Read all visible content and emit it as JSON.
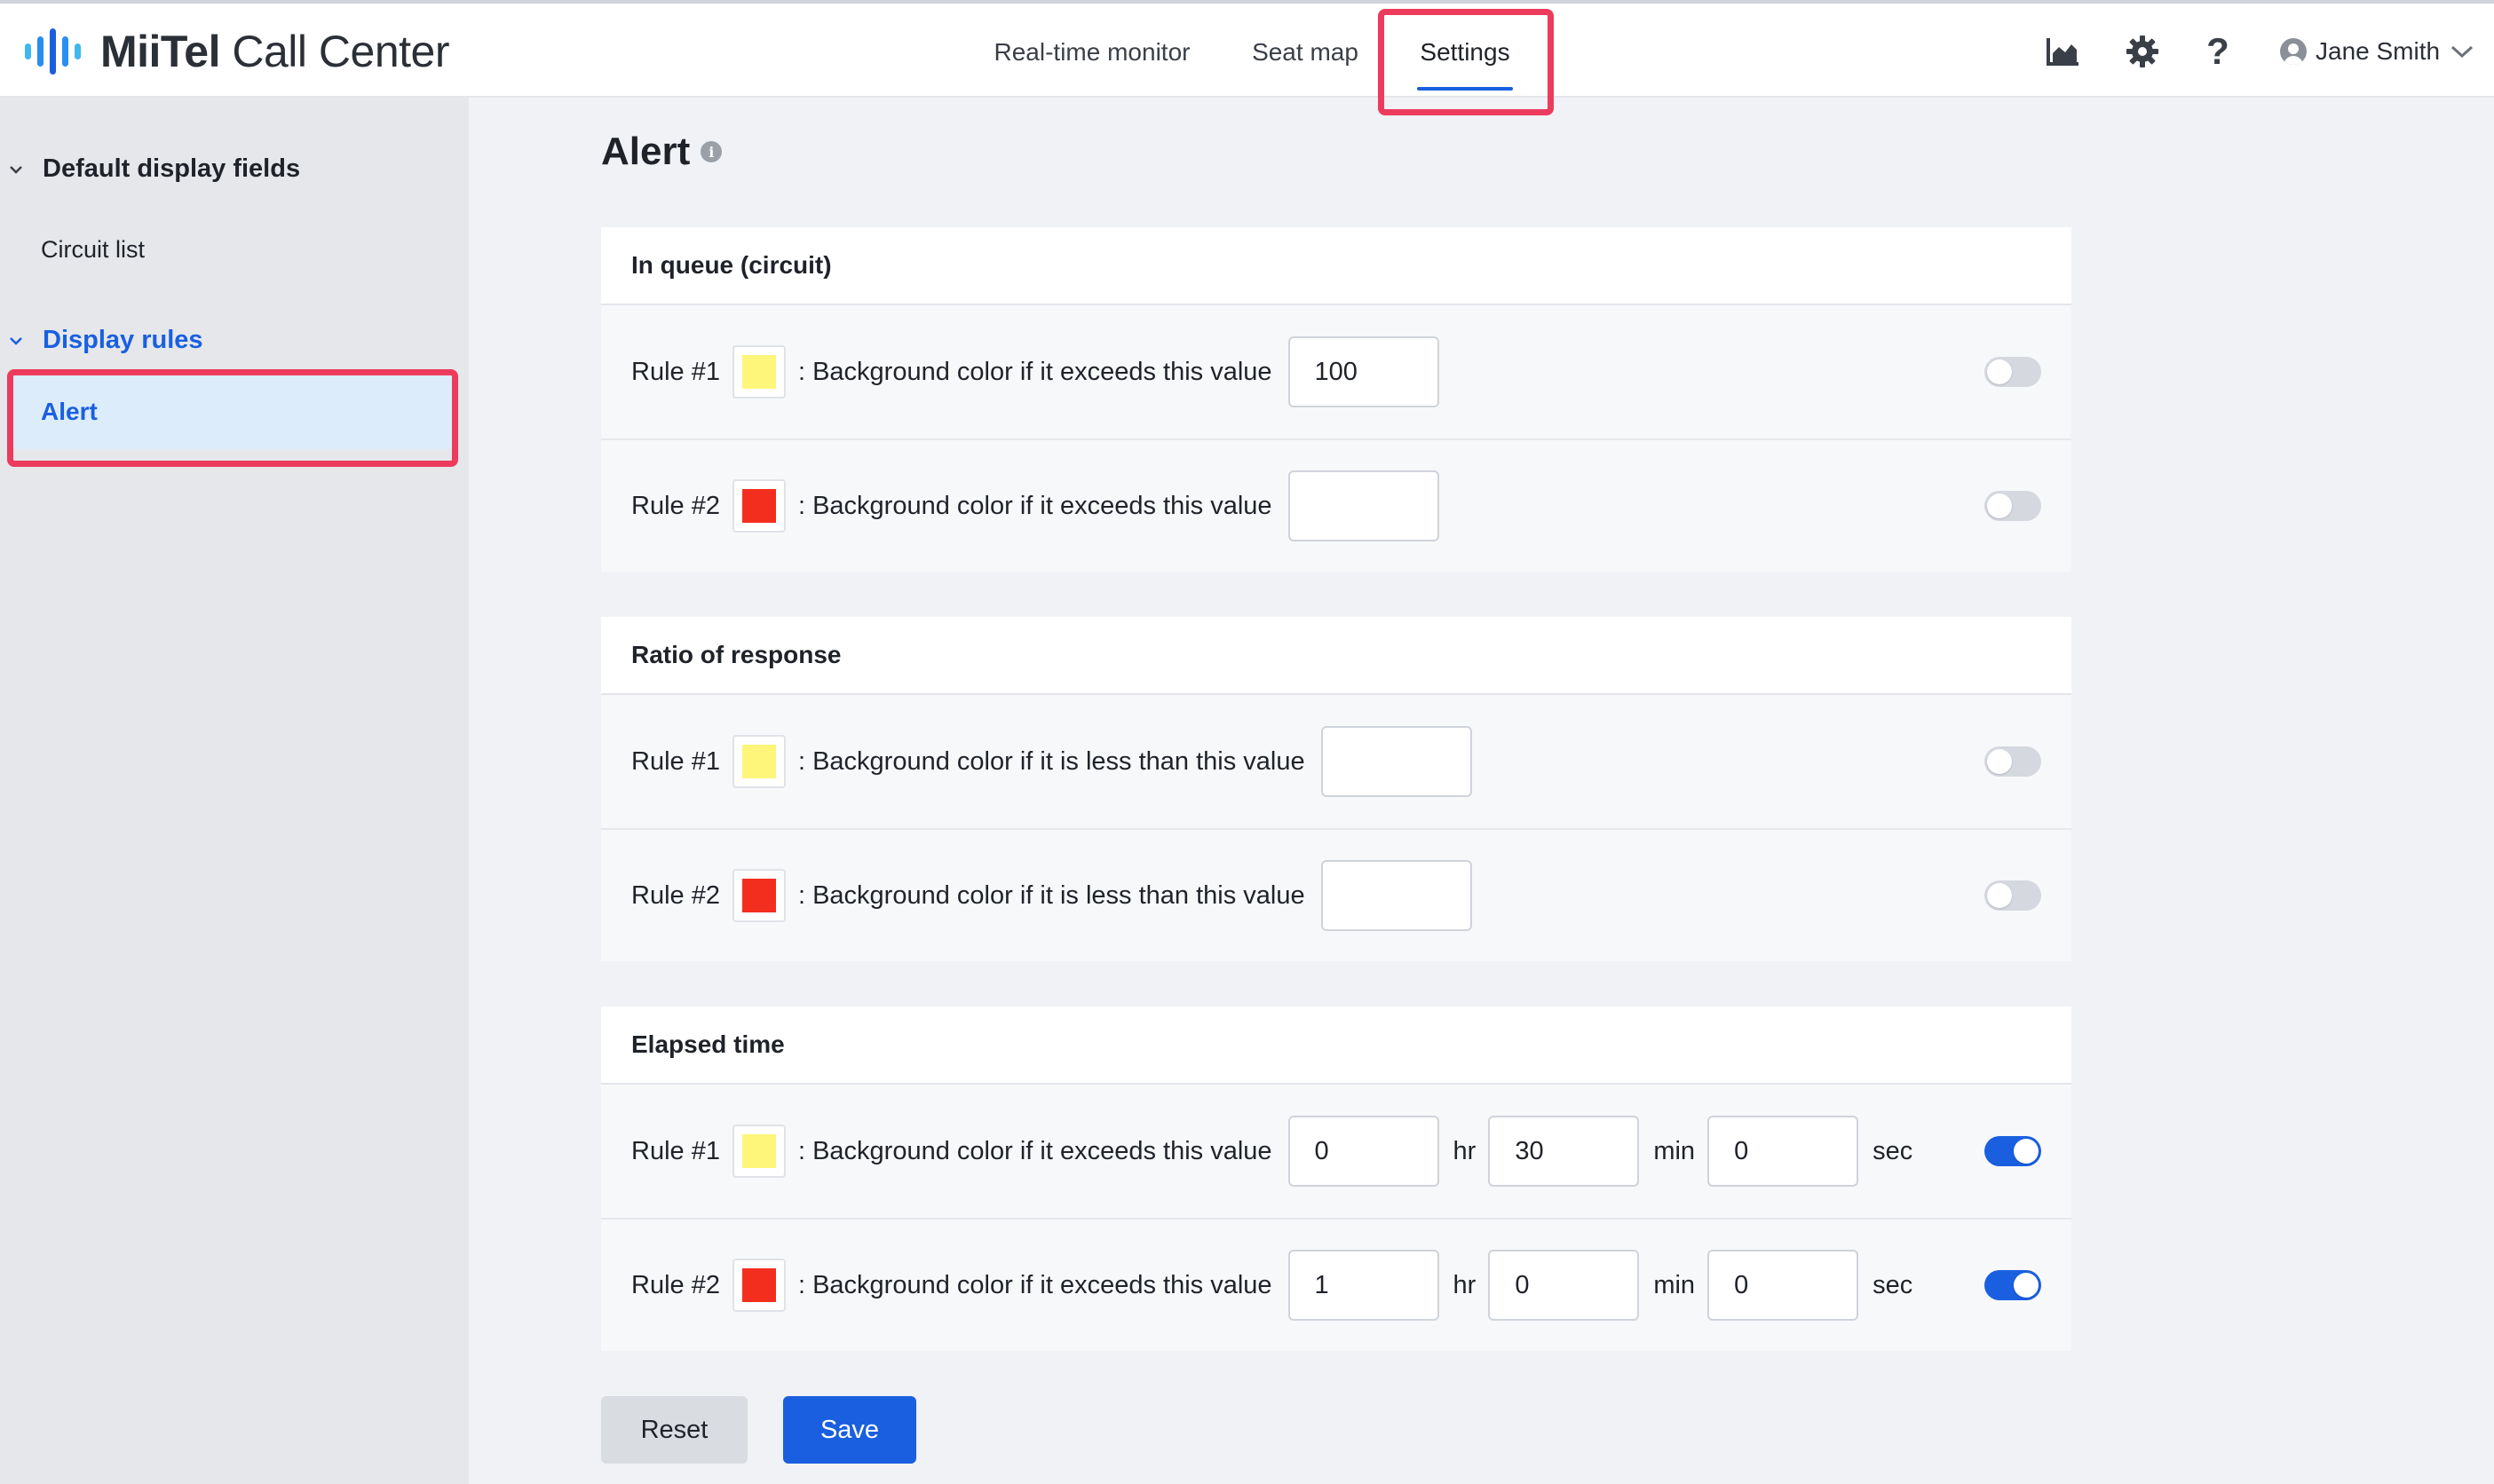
{
  "app": {
    "logo_brand": "MiiTel",
    "logo_product": "Call Center"
  },
  "nav": {
    "tabs": [
      {
        "label": "Real-time monitor"
      },
      {
        "label": "Seat map"
      },
      {
        "label": "Settings",
        "active": true
      }
    ]
  },
  "header_icons": [
    "chart-icon",
    "gear-icon",
    "help-icon"
  ],
  "user": {
    "name": "Jane Smith"
  },
  "sidebar": {
    "groups": [
      {
        "label": "Default display fields",
        "items": [
          "Circuit list"
        ]
      },
      {
        "label": "Display rules",
        "items": [
          "Alert"
        ],
        "active_item": "Alert"
      }
    ]
  },
  "page": {
    "title": "Alert",
    "info_icon": "info-icon"
  },
  "colors": {
    "accent": "#1a5fe0",
    "highlight": "#ec3b5d",
    "rule1_color": "#fdf67a",
    "rule2_color": "#f42e1e"
  },
  "sections": [
    {
      "title": "In queue (circuit)",
      "rules": [
        {
          "label": "Rule #1",
          "text": ": Background color if it exceeds this value",
          "value": "100",
          "enabled": false
        },
        {
          "label": "Rule #2",
          "text": ": Background color if it exceeds this value",
          "value": "",
          "enabled": false
        }
      ]
    },
    {
      "title": "Ratio of response",
      "rules": [
        {
          "label": "Rule #1",
          "text": ": Background color if it is less than this value",
          "value": "",
          "enabled": false
        },
        {
          "label": "Rule #2",
          "text": ": Background color if it is less than this value",
          "value": "",
          "enabled": false
        }
      ]
    },
    {
      "title": "Elapsed time",
      "rules": [
        {
          "label": "Rule #1",
          "text": ": Background color if it exceeds this value",
          "hr": "0",
          "min": "30",
          "sec": "0",
          "enabled": true
        },
        {
          "label": "Rule #2",
          "text": ": Background color if it exceeds this value",
          "hr": "1",
          "min": "0",
          "sec": "0",
          "enabled": true
        }
      ]
    }
  ],
  "units": {
    "hr": "hr",
    "min": "min",
    "sec": "sec"
  },
  "buttons": {
    "reset": "Reset",
    "save": "Save"
  }
}
